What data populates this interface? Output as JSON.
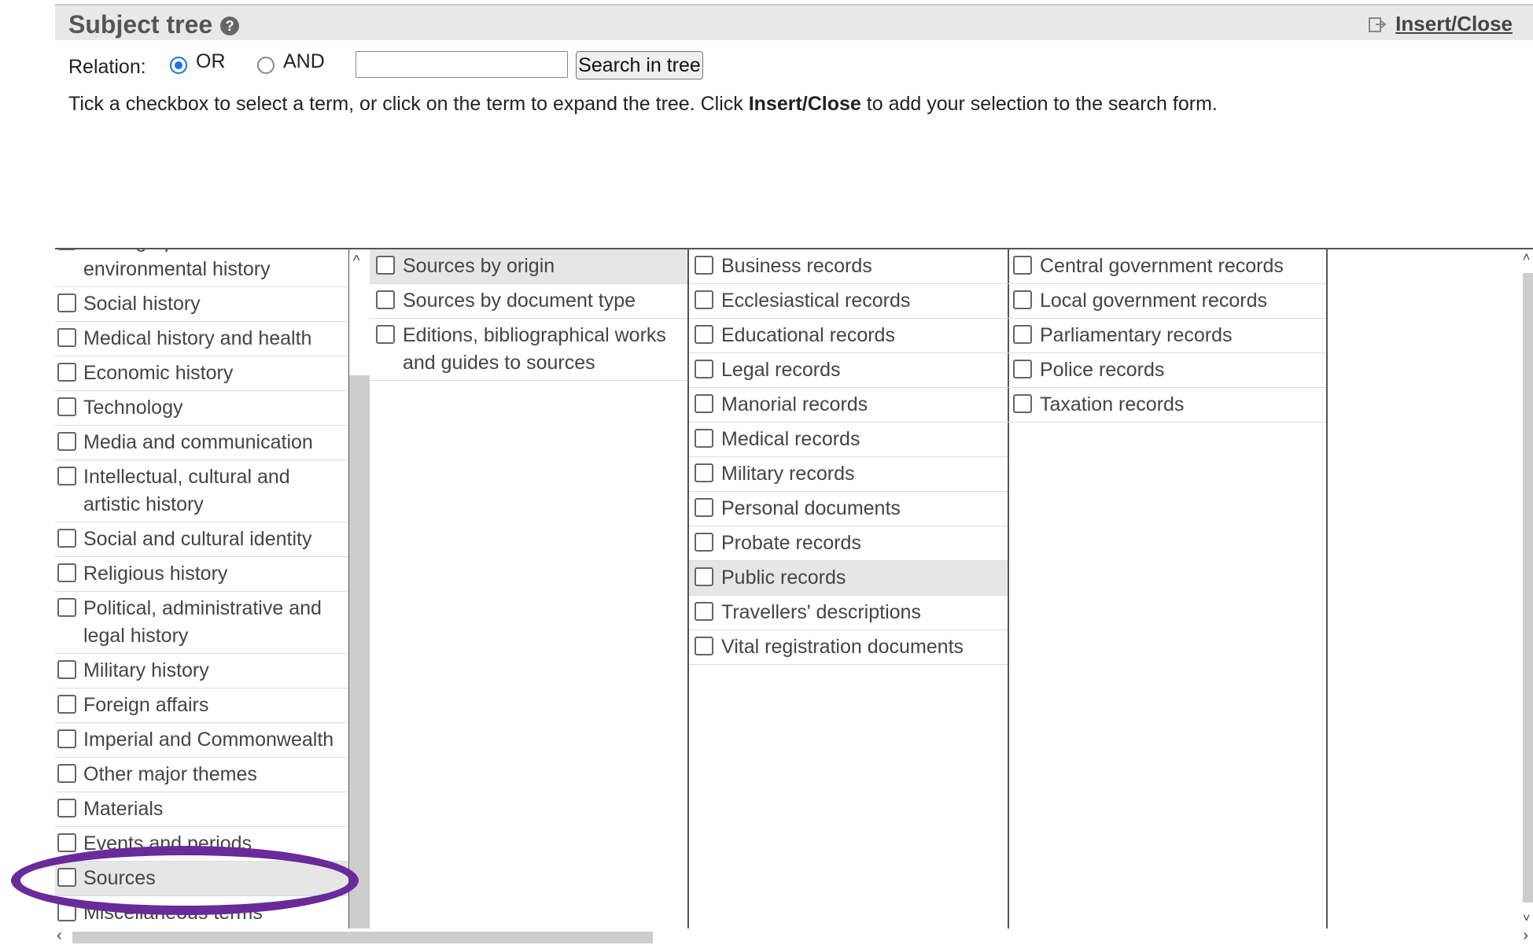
{
  "header": {
    "title": "Subject tree",
    "help_glyph": "?",
    "insert_close_label": "Insert/Close"
  },
  "relation": {
    "label": "Relation:",
    "options": [
      {
        "label": "OR",
        "checked": true
      },
      {
        "label": "AND",
        "checked": false
      }
    ],
    "search_value": "",
    "search_button": "Search in tree"
  },
  "instructions": {
    "before": "Tick a checkbox to select a term, or click on the term to expand the tree. Click ",
    "bold": "Insert/Close",
    "after": " to add your selection to the search form."
  },
  "tree": {
    "col1": [
      {
        "label": "Demographic and environmental history",
        "selected": false
      },
      {
        "label": "Social history",
        "selected": false
      },
      {
        "label": "Medical history and health",
        "selected": false
      },
      {
        "label": "Economic history",
        "selected": false
      },
      {
        "label": "Technology",
        "selected": false
      },
      {
        "label": "Media and communication",
        "selected": false
      },
      {
        "label": "Intellectual, cultural and artistic history",
        "selected": false
      },
      {
        "label": "Social and cultural identity",
        "selected": false
      },
      {
        "label": "Religious history",
        "selected": false
      },
      {
        "label": "Political, administrative and legal history",
        "selected": false
      },
      {
        "label": "Military history",
        "selected": false
      },
      {
        "label": "Foreign affairs",
        "selected": false
      },
      {
        "label": "Imperial and Commonwealth",
        "selected": false
      },
      {
        "label": "Other major themes",
        "selected": false
      },
      {
        "label": "Materials",
        "selected": false
      },
      {
        "label": "Events and periods",
        "selected": false
      },
      {
        "label": "Sources",
        "selected": true
      },
      {
        "label": "Miscellaneous terms",
        "selected": false
      }
    ],
    "col2": [
      {
        "label": "Sources by origin",
        "selected": true
      },
      {
        "label": "Sources by document type",
        "selected": false
      },
      {
        "label": "Editions, bibliographical works and guides to sources",
        "selected": false
      }
    ],
    "col3": [
      {
        "label": "Business records",
        "selected": false
      },
      {
        "label": "Ecclesiastical records",
        "selected": false
      },
      {
        "label": "Educational records",
        "selected": false
      },
      {
        "label": "Legal records",
        "selected": false
      },
      {
        "label": "Manorial records",
        "selected": false
      },
      {
        "label": "Medical records",
        "selected": false
      },
      {
        "label": "Military records",
        "selected": false
      },
      {
        "label": "Personal documents",
        "selected": false
      },
      {
        "label": "Probate records",
        "selected": false
      },
      {
        "label": "Public records",
        "selected": true
      },
      {
        "label": "Travellers' descriptions",
        "selected": false
      },
      {
        "label": "Vital registration documents",
        "selected": false
      }
    ],
    "col4": [
      {
        "label": "Central government records",
        "selected": false
      },
      {
        "label": "Local government records",
        "selected": false
      },
      {
        "label": "Parliamentary records",
        "selected": false
      },
      {
        "label": "Police records",
        "selected": false
      },
      {
        "label": "Taxation records",
        "selected": false
      }
    ]
  },
  "annotation": {
    "color": "#6a2a9a"
  }
}
